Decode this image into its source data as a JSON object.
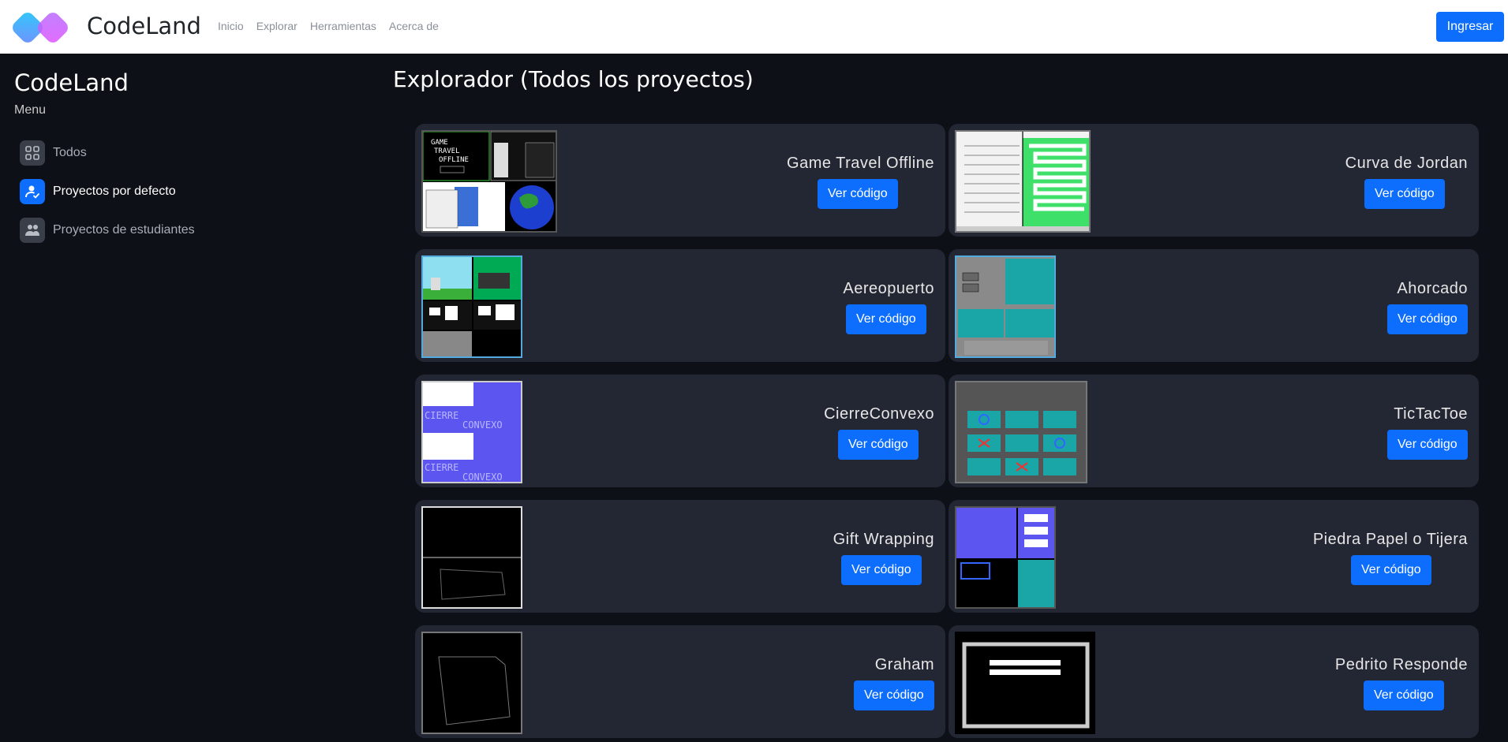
{
  "navbar": {
    "brand": "CodeLand",
    "links": [
      "Inicio",
      "Explorar",
      "Herramientas",
      "Acerca de"
    ],
    "login_label": "Ingresar"
  },
  "sidebar": {
    "title": "CodeLand",
    "subtitle": "Menu",
    "items": [
      {
        "label": "Todos",
        "icon": "grid-icon"
      },
      {
        "label": "Proyectos por defecto",
        "icon": "user-check-icon"
      },
      {
        "label": "Proyectos de estudiantes",
        "icon": "users-icon"
      }
    ]
  },
  "main": {
    "title": "Explorador (Todos los proyectos)",
    "button_label": "Ver código",
    "projects": [
      {
        "name": "Game Travel Offline"
      },
      {
        "name": "Curva de Jordan"
      },
      {
        "name": "Aereopuerto"
      },
      {
        "name": "Ahorcado"
      },
      {
        "name": "CierreConvexo"
      },
      {
        "name": "TicTacToe"
      },
      {
        "name": "Gift Wrapping"
      },
      {
        "name": "Piedra Papel o Tijera"
      },
      {
        "name": "Graham"
      },
      {
        "name": "Pedrito Responde"
      }
    ]
  },
  "colors": {
    "accent": "#0d6efd",
    "background": "#0d1117",
    "card": "#232633"
  }
}
